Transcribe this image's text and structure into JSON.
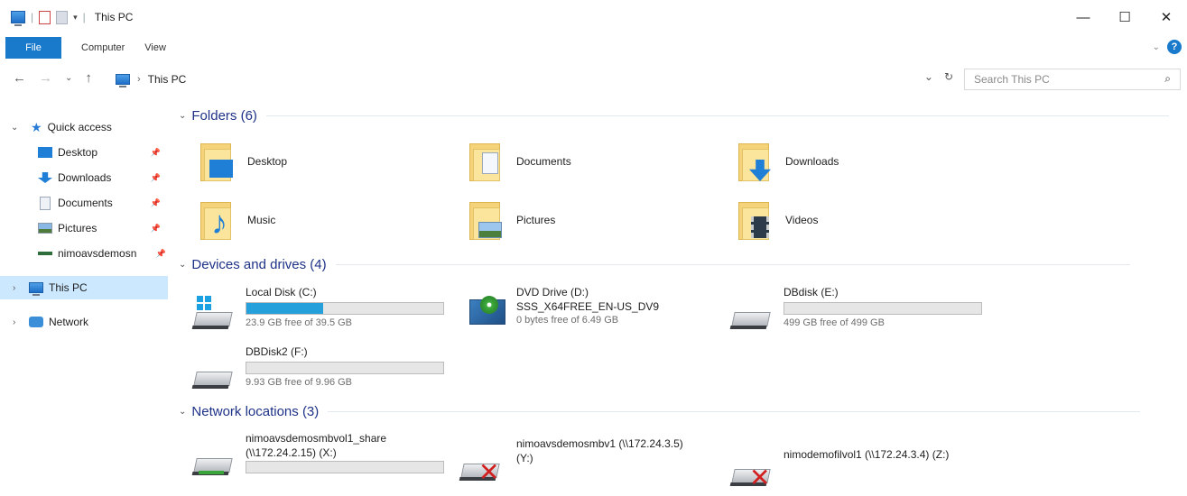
{
  "window": {
    "title": "This PC",
    "controls": {
      "minimize": "—",
      "maximize": "☐",
      "close": "✕"
    }
  },
  "ribbon": {
    "tabs": [
      {
        "label": "File",
        "active": true
      },
      {
        "label": "Computer"
      },
      {
        "label": "View"
      }
    ]
  },
  "address": {
    "path": "This PC",
    "search_placeholder": "Search This PC"
  },
  "navpane": {
    "quick_access": "Quick access",
    "items": [
      {
        "label": "Desktop",
        "icon": "desktop-icon",
        "pinned": true
      },
      {
        "label": "Downloads",
        "icon": "downloads-icon",
        "pinned": true
      },
      {
        "label": "Documents",
        "icon": "documents-icon",
        "pinned": true
      },
      {
        "label": "Pictures",
        "icon": "pictures-icon",
        "pinned": true
      },
      {
        "label": "nimoavsdemosn",
        "icon": "network-drive-icon",
        "pinned": true
      }
    ],
    "this_pc": "This PC",
    "network": "Network"
  },
  "groups": {
    "folders": "Folders (6)",
    "devices": "Devices and drives (4)",
    "network": "Network locations (3)"
  },
  "folders": [
    {
      "label": "Desktop",
      "icon": "desktop-folder-icon"
    },
    {
      "label": "Documents",
      "icon": "documents-folder-icon"
    },
    {
      "label": "Downloads",
      "icon": "downloads-folder-icon"
    },
    {
      "label": "Music",
      "icon": "music-folder-icon"
    },
    {
      "label": "Pictures",
      "icon": "pictures-folder-icon"
    },
    {
      "label": "Videos",
      "icon": "videos-folder-icon"
    }
  ],
  "drives": [
    {
      "name": "Local Disk (C:)",
      "free": "23.9 GB free of 39.5 GB",
      "used_fraction": 0.39
    },
    {
      "name": "DVD Drive (D:)",
      "label2": "SSS_X64FREE_EN-US_DV9",
      "free": "0 bytes free of 6.49 GB"
    },
    {
      "name": "DBdisk (E:)",
      "free": "499 GB free of 499 GB",
      "used_fraction": 0.0
    },
    {
      "name": "DBDisk2 (F:)",
      "free": "9.93 GB free of 9.96 GB",
      "used_fraction": 0.0
    }
  ],
  "network_locations": [
    {
      "line1": "nimoavsdemosmbvol1_share",
      "line2": "(\\\\172.24.2.15) (X:)",
      "used_fraction": 0.0
    },
    {
      "line1": "nimoavsdemosmbv1 (\\\\172.24.3.5)",
      "line2": "(Y:)",
      "disconnected": true
    },
    {
      "line1": "nimodemofilvol1 (\\\\172.24.3.4) (Z:)",
      "disconnected": true
    }
  ]
}
